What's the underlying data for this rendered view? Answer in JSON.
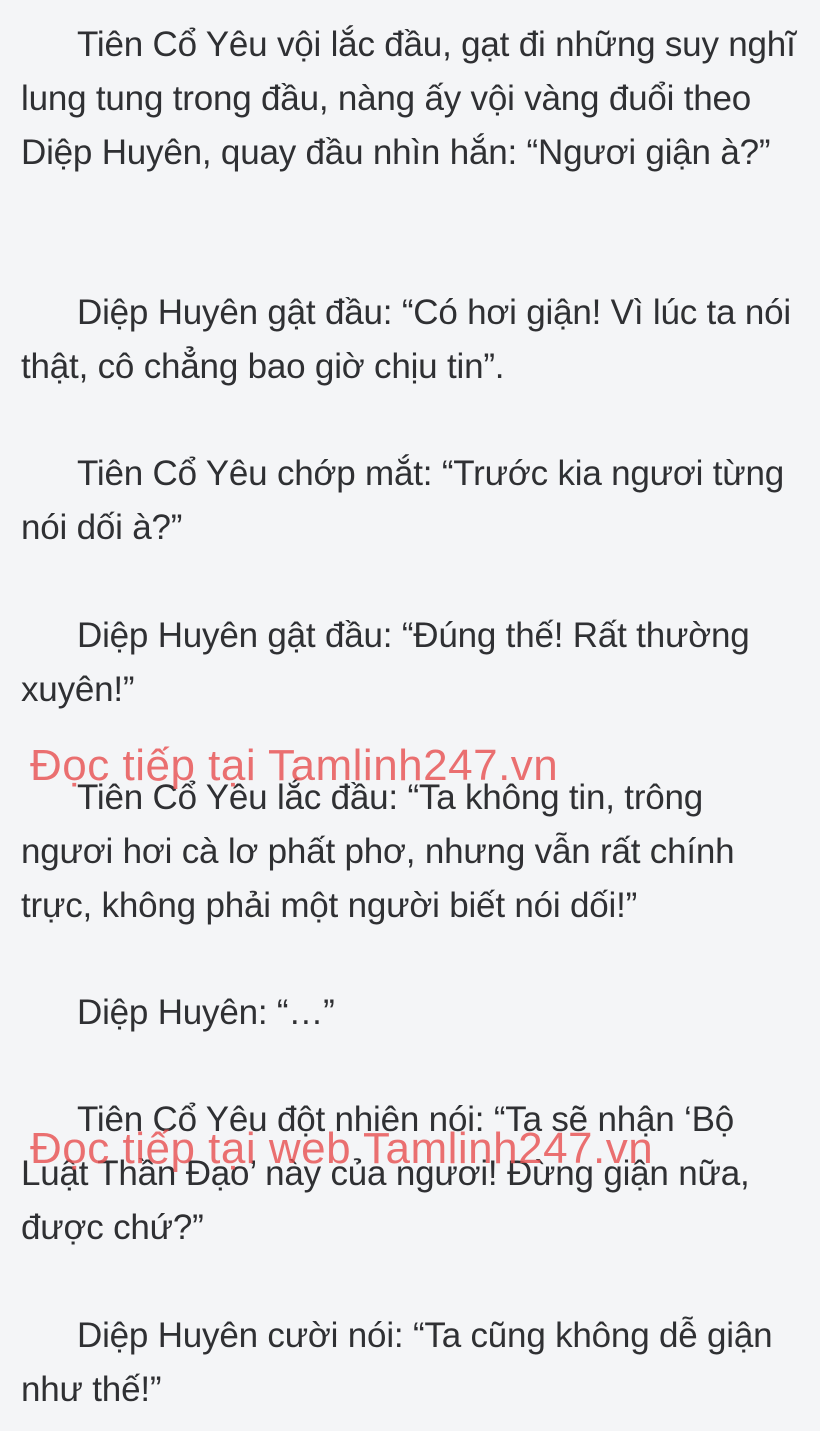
{
  "paragraphs": [
    "Tiên Cổ Yêu vội lắc đầu, gạt đi những suy nghĩ lung tung trong đầu, nàng ấy vội vàng đuổi theo Diệp Huyên, quay đầu nhìn hắn: “Ngươi giận à?”",
    "Diệp Huyên gật đầu: “Có hơi giận! Vì lúc ta nói thật, cô chẳng bao giờ chịu tin”.",
    "Tiên Cổ Yêu chớp mắt: “Trước kia ngươi từng nói dối à?”",
    "Diệp Huyên gật đầu: “Đúng thế! Rất thường xuyên!”",
    "Tiên Cổ Yêu lắc đầu: “Ta không tin, trông ngươi hơi cà lơ phất phơ, nhưng vẫn rất chính trực, không phải một người biết nói dối!”",
    "Diệp Huyên: “…”",
    "Tiên Cổ Yêu đột nhiên nói: “Ta sẽ nhận ‘Bộ Luật Thần Đạo’ này của ngươi! Đừng giận nữa, được chứ?”",
    "Diệp Huyên cười nói: “Ta cũng không dễ giận như thế!”"
  ],
  "watermarks": [
    "Đọc tiếp tại Tamlinh247.vn",
    "Đọc tiếp tại web Tamlinh247.vn"
  ],
  "colors": {
    "background": "#f4f5f7",
    "text": "#2f3033",
    "watermark": "#e85252"
  }
}
